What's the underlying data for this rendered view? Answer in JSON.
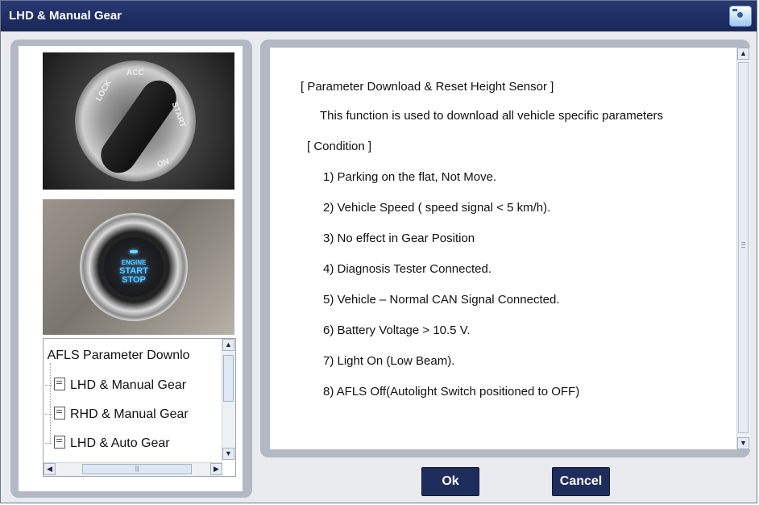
{
  "window": {
    "title": "LHD & Manual Gear",
    "icon": "camera-icon"
  },
  "left": {
    "ignition_labels": [
      "LOCK",
      "ACC",
      "START",
      "ON"
    ],
    "start_button_label": [
      "ENGINE",
      "START",
      "STOP"
    ],
    "tree": {
      "root": "AFLS Parameter Downlo",
      "items": [
        "LHD & Manual Gear",
        "RHD & Manual Gear",
        "LHD & Auto Gear"
      ]
    }
  },
  "content": {
    "lines": [
      "[ Parameter Download & Reset Height Sensor ]",
      "This function is used to download all vehicle specific parameters",
      "[ Condition ]",
      "1) Parking on the flat, Not Move.",
      "2) Vehicle Speed ( speed signal < 5 km/h).",
      "3) No effect in Gear Position",
      "4) Diagnosis Tester Connected.",
      "5) Vehicle – Normal CAN Signal Connected.",
      "6) Battery Voltage > 10.5 V.",
      "7) Light On (Low Beam).",
      "8) AFLS Off(Autolight Switch positioned to OFF)"
    ]
  },
  "buttons": {
    "ok": "Ok",
    "cancel": "Cancel"
  },
  "colors": {
    "titlebar": "#1e2c63",
    "button": "#1f2d5c",
    "panel": "#b2b9c4"
  }
}
